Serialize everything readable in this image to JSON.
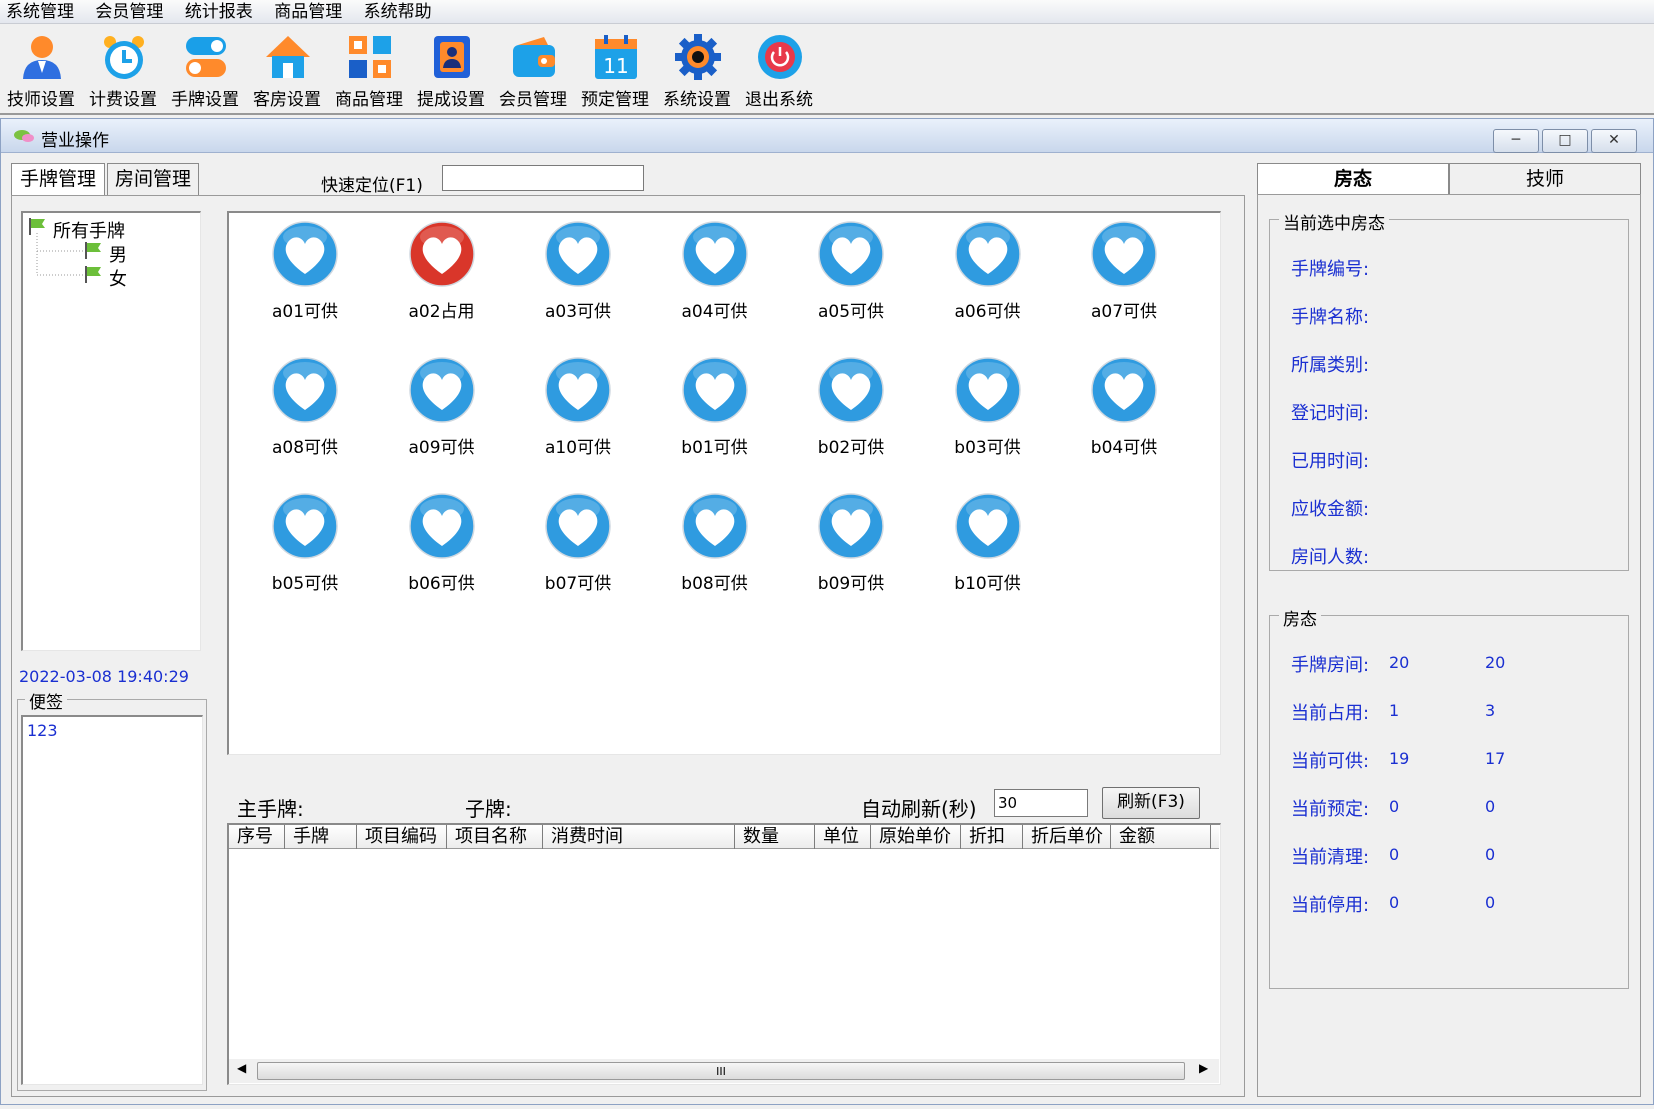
{
  "menubar": [
    "系统管理",
    "会员管理",
    "统计报表",
    "商品管理",
    "系统帮助"
  ],
  "toolbar": [
    {
      "label": "技师设置",
      "icon": "technician-icon"
    },
    {
      "label": "计费设置",
      "icon": "alarm-clock-icon"
    },
    {
      "label": "手牌设置",
      "icon": "toggle-icon"
    },
    {
      "label": "客房设置",
      "icon": "house-icon"
    },
    {
      "label": "商品管理",
      "icon": "grid-icon"
    },
    {
      "label": "提成设置",
      "icon": "contact-icon"
    },
    {
      "label": "会员管理",
      "icon": "wallet-icon"
    },
    {
      "label": "预定管理",
      "icon": "calendar-icon"
    },
    {
      "label": "系统设置",
      "icon": "gear-icon"
    },
    {
      "label": "退出系统",
      "icon": "power-icon"
    }
  ],
  "calendar_day": "11",
  "window": {
    "title": "营业操作"
  },
  "left_tabs": [
    "手牌管理",
    "房间管理"
  ],
  "quick_locate": {
    "label": "快速定位(F1)",
    "value": ""
  },
  "tree": {
    "root": "所有手牌",
    "children": [
      "男",
      "女"
    ]
  },
  "datetime": "2022-03-08 19:40:29",
  "memo": {
    "title": "便签",
    "text": "123"
  },
  "hand_tags": [
    {
      "label": "a01可供",
      "status": "available"
    },
    {
      "label": "a02占用",
      "status": "occupied"
    },
    {
      "label": "a03可供",
      "status": "available"
    },
    {
      "label": "a04可供",
      "status": "available"
    },
    {
      "label": "a05可供",
      "status": "available"
    },
    {
      "label": "a06可供",
      "status": "available"
    },
    {
      "label": "a07可供",
      "status": "available"
    },
    {
      "label": "a08可供",
      "status": "available"
    },
    {
      "label": "a09可供",
      "status": "available"
    },
    {
      "label": "a10可供",
      "status": "available"
    },
    {
      "label": "b01可供",
      "status": "available"
    },
    {
      "label": "b02可供",
      "status": "available"
    },
    {
      "label": "b03可供",
      "status": "available"
    },
    {
      "label": "b04可供",
      "status": "available"
    },
    {
      "label": "b05可供",
      "status": "available"
    },
    {
      "label": "b06可供",
      "status": "available"
    },
    {
      "label": "b07可供",
      "status": "available"
    },
    {
      "label": "b08可供",
      "status": "available"
    },
    {
      "label": "b09可供",
      "status": "available"
    },
    {
      "label": "b10可供",
      "status": "available"
    }
  ],
  "colors": {
    "available": "#2f9be0",
    "occupied": "#d9362a",
    "label_blue": "#1a2fd1"
  },
  "bottom": {
    "main_tag_label": "主手牌:",
    "sub_tag_label": "子牌:",
    "auto_refresh_label": "自动刷新(秒)",
    "auto_refresh_value": "30",
    "refresh_button": "刷新(F3)"
  },
  "grid_columns": [
    "序号",
    "手牌",
    "项目编码",
    "项目名称",
    "消费时间",
    "数量",
    "单位",
    "原始单价",
    "折扣",
    "折后单价",
    "金额"
  ],
  "right_tabs": [
    "房态",
    "技师"
  ],
  "current_room": {
    "title": "当前选中房态",
    "fields": [
      "手牌编号:",
      "手牌名称:",
      "所属类别:",
      "登记时间:",
      "已用时间:",
      "应收金额:",
      "房间人数:"
    ]
  },
  "room_status": {
    "title": "房态",
    "rows": [
      {
        "label": "手牌房间:",
        "v1": "20",
        "v2": "20"
      },
      {
        "label": "当前占用:",
        "v1": "1",
        "v2": "3"
      },
      {
        "label": "当前可供:",
        "v1": "19",
        "v2": "17"
      },
      {
        "label": "当前预定:",
        "v1": "0",
        "v2": "0"
      },
      {
        "label": "当前清理:",
        "v1": "0",
        "v2": "0"
      },
      {
        "label": "当前停用:",
        "v1": "0",
        "v2": "0"
      }
    ]
  },
  "scrollbar_grip": "III"
}
